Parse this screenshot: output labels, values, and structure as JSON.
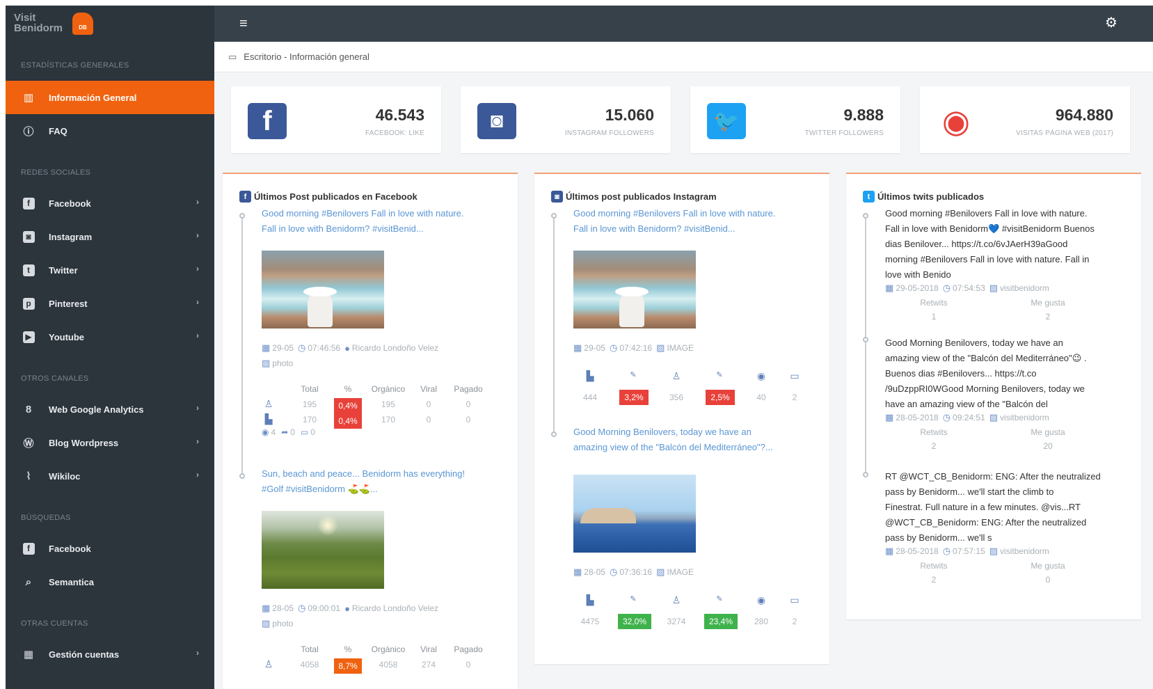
{
  "header": {
    "brand": "Visit\nBenidorm",
    "badge": "DB"
  },
  "breadcrumb": {
    "text": "Escritorio - Información general"
  },
  "sidebar": {
    "sec_general": "ESTADÍSTICAS GENERALES",
    "info_general": "Información General",
    "faq": "FAQ",
    "sec_redes": "REDES SOCIALES",
    "facebook": "Facebook",
    "instagram": "Instagram",
    "twitter": "Twitter",
    "pinterest": "Pinterest",
    "youtube": "Youtube",
    "sec_otros": "OTROS CANALES",
    "analytics": "Web Google Analytics",
    "wordpress": "Blog Wordpress",
    "wikiloc": "Wikiloc",
    "sec_busquedas": "BÚSQUEDAS",
    "b_facebook": "Facebook",
    "semantica": "Semantica",
    "sec_otras": "OTRAS CUENTAS",
    "gestion": "Gestión cuentas"
  },
  "stats": {
    "facebook": {
      "value": "46.543",
      "label": "FACEBOOK: LIKE",
      "color": "#3b5998"
    },
    "instagram": {
      "value": "15.060",
      "label": "INSTAGRAM FOLLOWERS",
      "color": "#3b5998"
    },
    "twitter": {
      "value": "9.888",
      "label": "TWITTER FOLLOWERS",
      "color": "#1da1f2"
    },
    "web": {
      "value": "964.880",
      "label": "VISITAS PÁGINA WEB (2017)",
      "color": "#e8413a"
    }
  },
  "facebook_panel": {
    "title": "Últimos Post publicados en Facebook",
    "post1": {
      "text": "Good morning #Benilovers Fall in love with nature.\nFall in love with Benidorm? #visitBenid...",
      "date": "29-05",
      "time": "07:46:56",
      "author": "Ricardo Londoño Velez",
      "type": "photo",
      "headers": [
        "Total",
        "%",
        "Orgánico",
        "Viral",
        "Pagado"
      ],
      "row1": {
        "total": "195",
        "pct": "0,4%",
        "organico": "195",
        "viral": "0",
        "pagado": "0"
      },
      "row2": {
        "total": "170",
        "pct": "0,4%",
        "organico": "170",
        "viral": "0",
        "pagado": "0"
      },
      "eye": "4",
      "share": "0",
      "comments": "0"
    },
    "post2": {
      "text": "Sun, beach and peace... Benidorm has everything!\n#Golf #visitBenidorm ⛳⛳...",
      "date": "28-05",
      "time": "09:00:01",
      "author": "Ricardo Londoño Velez",
      "type": "photo",
      "headers": [
        "Total",
        "%",
        "Orgánico",
        "Viral",
        "Pagado"
      ],
      "row1": {
        "total": "4058",
        "pct": "8,7%",
        "organico": "4058",
        "viral": "274",
        "pagado": "0"
      }
    }
  },
  "instagram_panel": {
    "title": "Últimos post publicados Instagram",
    "post1": {
      "text": "Good morning #Benilovers Fall in love with nature.\nFall in love with Benidorm? #visitBenid...",
      "date": "29-05",
      "time": "07:42:16",
      "type": "IMAGE",
      "stats": [
        "444",
        "3,2%",
        "356",
        "2,5%",
        "40",
        "2"
      ]
    },
    "post2": {
      "text": "Good Morning Benilovers, today we have an\namazing view of the \"Balcón del Mediterráneo\"?...",
      "date": "28-05",
      "time": "07:36:16",
      "type": "IMAGE",
      "stats": [
        "4475",
        "32,0%",
        "3274",
        "23,4%",
        "280",
        "2"
      ]
    }
  },
  "twitter_panel": {
    "title": "Últimos twits publicados",
    "t1": {
      "text": "Good morning #Benilovers Fall in love with nature.\nFall in love with Benidorm💙 #visitBenidorm Buenos\ndias Benilover... https://t.co/6vJAerH39aGood\nmorning #Benilovers Fall in love with nature. Fall in\nlove with Benido",
      "date": "29-05-2018",
      "time": "07:54:53",
      "user": "visitbenidorm",
      "retweets_label": "Retwits",
      "likes_label": "Me gusta",
      "retweets": "1",
      "likes": "2"
    },
    "t2": {
      "text": "Good Morning Benilovers, today we have an\namazing view of the \"Balcón del Mediterráneo\"😉 .\nBuenos dias #Benilovers... https://t.co\n/9uDzppRI0WGood Morning Benilovers, today we\nhave an amazing view of the \"Balcón del",
      "date": "28-05-2018",
      "time": "09:24:51",
      "user": "visitbenidorm",
      "retweets_label": "Retwits",
      "likes_label": "Me gusta",
      "retweets": "2",
      "likes": "20"
    },
    "t3": {
      "text": "RT @WCT_CB_Benidorm: ENG: After the neutralized\npass by Benidorm... we'll start the climb to\nFinestrat. Full nature in a few minutes. @vis...RT\n@WCT_CB_Benidorm: ENG: After the neutralized\npass by Benidorm... we'll s",
      "date": "28-05-2018",
      "time": "07:57:15",
      "user": "visitbenidorm",
      "retweets_label": "Retwits",
      "likes_label": "Me gusta",
      "retweets": "2",
      "likes": "0"
    }
  }
}
